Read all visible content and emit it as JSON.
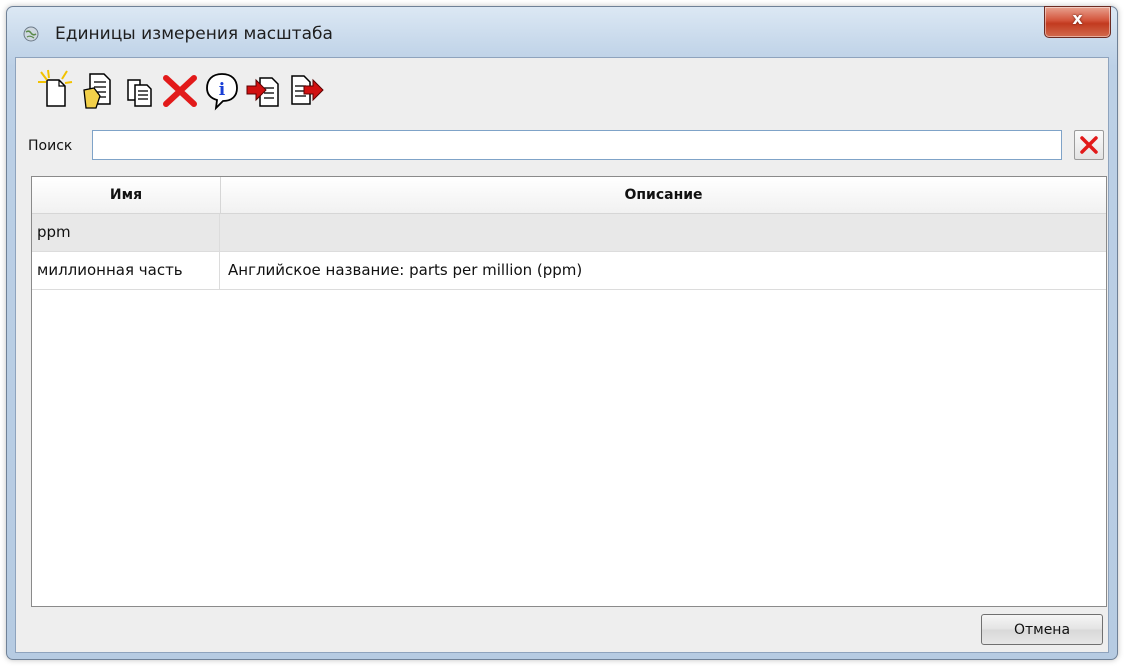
{
  "window": {
    "title": "Единицы измерения масштаба",
    "close_label": "x",
    "title_icon": "app-globe-icon"
  },
  "toolbar": {
    "icons": [
      "new-document-icon",
      "edit-document-icon",
      "copy-document-icon",
      "delete-icon",
      "info-icon",
      "import-icon",
      "export-icon"
    ]
  },
  "search": {
    "label": "Поиск",
    "value": "",
    "placeholder": "",
    "clear_icon": "clear-x-icon"
  },
  "table": {
    "columns": [
      "Имя",
      "Описание"
    ],
    "rows": [
      {
        "name": "ppm",
        "description": ""
      },
      {
        "name": "миллионная часть",
        "description": "Английское название: parts per million (ppm)"
      }
    ]
  },
  "footer": {
    "cancel_label": "Отмена"
  },
  "colors": {
    "delete_red": "#e21a1a",
    "info_blue": "#1a3fd6",
    "arrow_red": "#d11010",
    "doc_yellow": "#f2d04a"
  }
}
